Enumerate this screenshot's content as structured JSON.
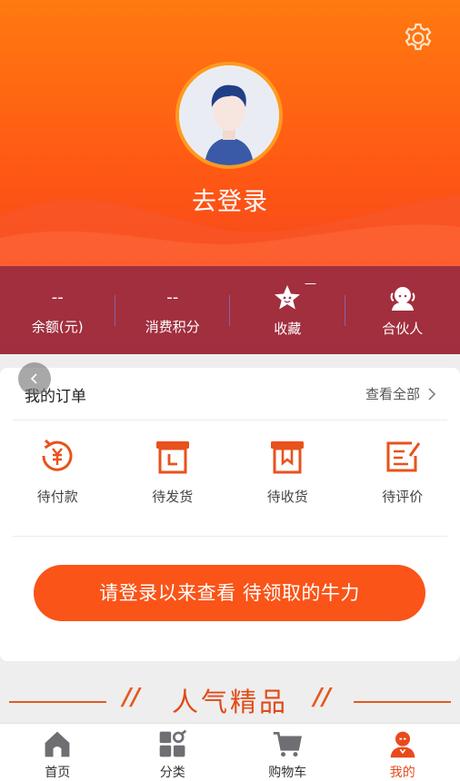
{
  "profile": {
    "login_text": "去登录",
    "avatar_icon": "user-avatar"
  },
  "stats": [
    {
      "value": "--",
      "label": "余额(元)"
    },
    {
      "value": "--",
      "label": "消费积分"
    },
    {
      "icon": "star-icon",
      "label": "收藏",
      "badge": "—"
    },
    {
      "icon": "partner-icon",
      "label": "合伙人"
    }
  ],
  "orders": {
    "title": "我的订单",
    "view_all": "查看全部",
    "items": [
      {
        "icon": "payment-icon",
        "label": "待付款"
      },
      {
        "icon": "shipping-box-icon",
        "label": "待发货"
      },
      {
        "icon": "receive-box-icon",
        "label": "待收货"
      },
      {
        "icon": "review-icon",
        "label": "待评价"
      }
    ]
  },
  "cta": {
    "label": "请登录以来查看 待领取的牛力"
  },
  "popular": {
    "title": "人气精品",
    "slash": "//"
  },
  "tabs": [
    {
      "icon": "home-icon",
      "label": "首页"
    },
    {
      "icon": "category-icon",
      "label": "分类"
    },
    {
      "icon": "cart-icon",
      "label": "购物车"
    },
    {
      "icon": "mine-icon",
      "label": "我的",
      "active": true
    }
  ],
  "colors": {
    "accent": "#fa5418",
    "header_top": "#ff7a10",
    "header_bottom": "#f23a1e",
    "stats_bar": "#8c2442",
    "icon_orange": "#e8521c",
    "tab_active": "#e84a1c"
  }
}
